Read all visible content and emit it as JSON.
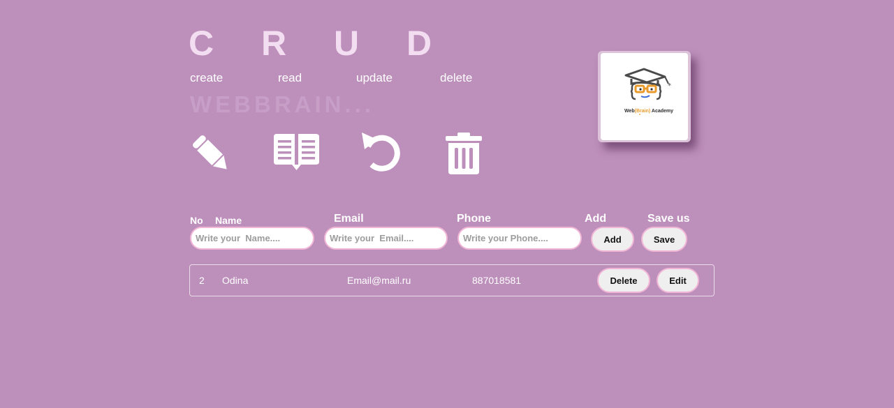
{
  "hero": {
    "letters": [
      "C",
      "R",
      "U",
      "D"
    ],
    "words": [
      "create",
      "read",
      "update",
      "delete"
    ],
    "brand": "WEBBRAIN..."
  },
  "icons": [
    "pencil-icon",
    "open-book-icon",
    "undo-icon",
    "trash-icon"
  ],
  "logo": {
    "text_left": "Web",
    "text_middle": "(Brain)",
    "text_right": " Academy",
    "accent_color": "#e89a2a"
  },
  "form": {
    "labels": {
      "no": "No",
      "name": "Name",
      "email": "Email",
      "phone": "Phone",
      "add": "Add",
      "save": "Save us"
    },
    "name_placeholder": "Write your  Name....",
    "email_placeholder": "Write your  Email....",
    "phone_placeholder": "Write your Phone....",
    "add_button": "Add",
    "save_button": "Save"
  },
  "rows": [
    {
      "no": "2",
      "name": "Odina",
      "email": "Email@mail.ru",
      "phone": "887018581",
      "delete_button": "Delete",
      "edit_button": "Edit"
    }
  ],
  "colors": {
    "background": "#bd8fbb",
    "input_border": "#f1b6d6",
    "title_letters": "#f3ddf0",
    "brand_text": "#c79ec6"
  }
}
